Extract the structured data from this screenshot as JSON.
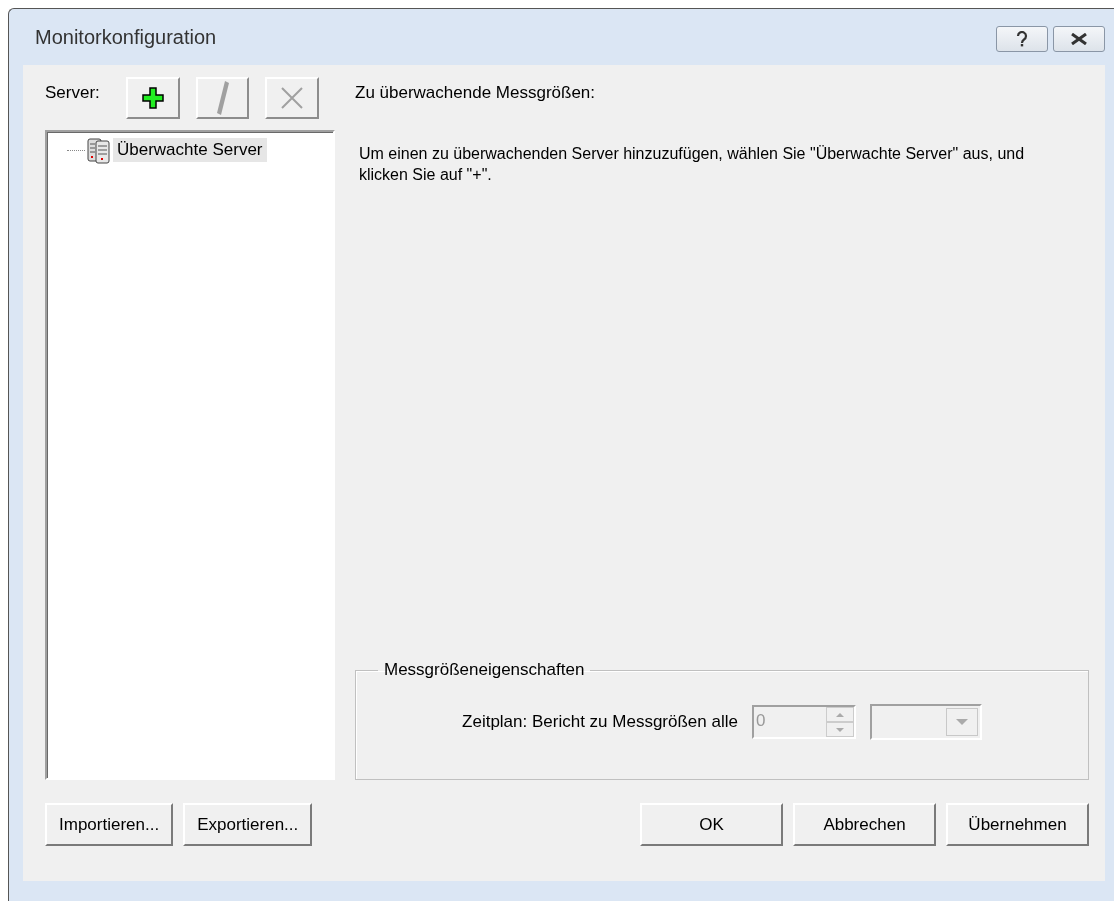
{
  "window": {
    "title": "Monitorkonfiguration"
  },
  "server_label": "Server:",
  "toolbar": [
    {
      "kind": "add",
      "disabled": false
    },
    {
      "kind": "edit",
      "disabled": true
    },
    {
      "kind": "delete",
      "disabled": true
    }
  ],
  "tree": [
    {
      "label": "Überwachte Server",
      "selected": true
    }
  ],
  "metrics_label": "Zu überwachende Messgrößen:",
  "hint": "Um einen zu überwachenden Server hinzuzufügen, wählen Sie \"Überwachte Server\" aus, und klicken Sie auf \"+\".",
  "properties": {
    "title": "Messgrößeneigenschaften",
    "schedule_label": "Zeitplan: Bericht zu Messgrößen alle",
    "interval": {
      "value": "0",
      "disabled": true
    },
    "unit": {
      "disabled": true
    }
  },
  "left_buttons": [
    "Importieren...",
    "Exportieren..."
  ],
  "dialog_buttons": [
    "OK",
    "Abbrechen",
    "Übernehmen"
  ]
}
